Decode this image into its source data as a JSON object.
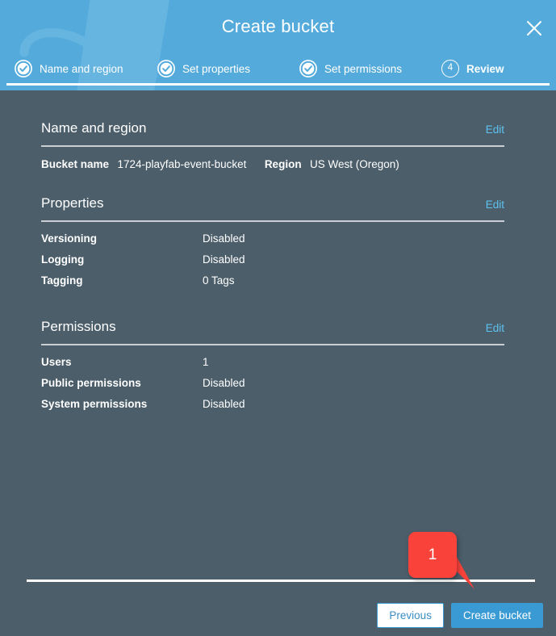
{
  "header": {
    "title": "Create bucket",
    "close_icon": "close-icon",
    "steps": [
      {
        "label": "Name and region",
        "state": "complete",
        "icon": "check-circle-icon",
        "number": "1"
      },
      {
        "label": "Set properties",
        "state": "complete",
        "icon": "check-circle-icon",
        "number": "2"
      },
      {
        "label": "Set permissions",
        "state": "complete",
        "icon": "check-circle-icon",
        "number": "3"
      },
      {
        "label": "Review",
        "state": "current",
        "icon": "step-number-icon",
        "number": "4"
      }
    ]
  },
  "sections": [
    {
      "title": "Name and region",
      "edit_label": "Edit",
      "inline_pairs": [
        {
          "label": "Bucket name",
          "value": "1724-playfab-event-bucket"
        },
        {
          "label": "Region",
          "value": "US West (Oregon)"
        }
      ]
    },
    {
      "title": "Properties",
      "edit_label": "Edit",
      "rows": [
        {
          "label": "Versioning",
          "value": "Disabled"
        },
        {
          "label": "Logging",
          "value": "Disabled"
        },
        {
          "label": "Tagging",
          "value": "0 Tags"
        }
      ]
    },
    {
      "title": "Permissions",
      "edit_label": "Edit",
      "rows": [
        {
          "label": "Users",
          "value": "1"
        },
        {
          "label": "Public permissions",
          "value": "Disabled"
        },
        {
          "label": "System permissions",
          "value": "Disabled"
        }
      ]
    }
  ],
  "footer": {
    "previous_label": "Previous",
    "create_label": "Create bucket"
  },
  "annotation": {
    "number": "1"
  },
  "colors": {
    "header_blue": "#54abdb",
    "body_slate": "#4b5e6a",
    "link_blue": "#5ec2f0",
    "primary_button": "#3a9ad4",
    "callout_red": "#f8423a",
    "rule_white": "#ffffff",
    "section_rule": "#c9cfd3"
  }
}
